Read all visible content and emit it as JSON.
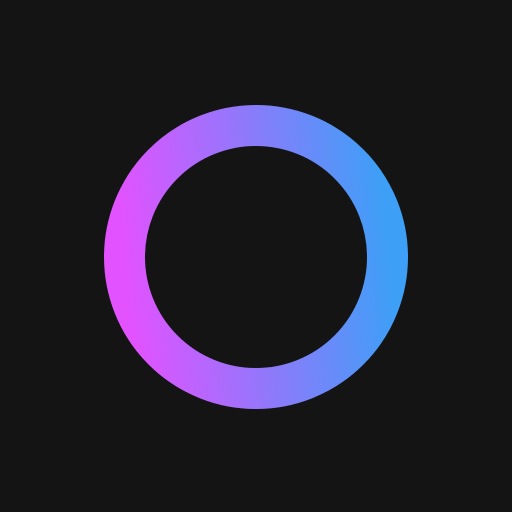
{
  "app": {
    "icon": "gradient-ring-logo",
    "colors": {
      "background": "#141414",
      "gradient_start": "#E252FF",
      "gradient_end": "#3E9FF7"
    }
  }
}
